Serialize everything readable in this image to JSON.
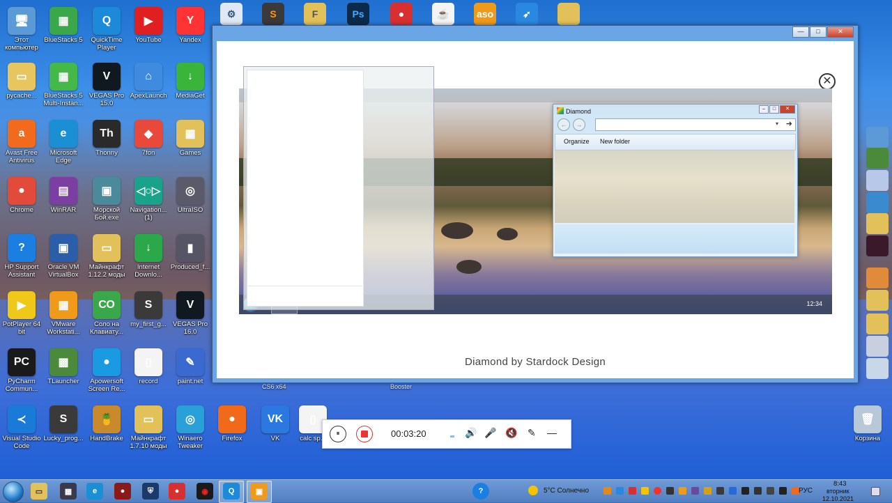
{
  "desktop_icons": [
    {
      "label": "Этот компьютер",
      "glyph": "🖥",
      "color": "#5b9ad6",
      "icon": "computer-icon"
    },
    {
      "label": "BlueStacks 5",
      "glyph": "▦",
      "color": "#3aa84a",
      "icon": "bluestacks-icon"
    },
    {
      "label": "QuickTime Player",
      "glyph": "Q",
      "color": "#1c8ad8",
      "icon": "quicktime-icon"
    },
    {
      "label": "YouTube",
      "glyph": "▶",
      "color": "#e02020",
      "icon": "youtube-icon"
    },
    {
      "label": "Yandex",
      "glyph": "Y",
      "color": "#f33",
      "icon": "yandex-icon"
    },
    {
      "label": "рycache...",
      "glyph": "▭",
      "color": "#e7c660",
      "icon": "folder-icon"
    },
    {
      "label": "BlueStacks 5 Multi-Instan...",
      "glyph": "▦",
      "color": "#45b84a",
      "icon": "bluestacks-multi-icon"
    },
    {
      "label": "VEGAS Pro 15.0",
      "glyph": "V",
      "color": "#101820",
      "icon": "vegas-icon"
    },
    {
      "label": "ApexLaunch",
      "glyph": "⌂",
      "color": "#3f8be0",
      "icon": "apexlauncher-icon"
    },
    {
      "label": "MediaGet",
      "glyph": "↓",
      "color": "#3bb43b",
      "icon": "mediaget-icon"
    },
    {
      "label": "Avast Free Antivirus",
      "glyph": "a",
      "color": "#f26a1b",
      "icon": "avast-icon"
    },
    {
      "label": "Microsoft Edge",
      "glyph": "e",
      "color": "#1a8fd4",
      "icon": "edge-icon"
    },
    {
      "label": "Thonny",
      "glyph": "Th",
      "color": "#2a2a2a",
      "icon": "thonny-icon"
    },
    {
      "label": "7fon",
      "glyph": "◆",
      "color": "#e9493a",
      "icon": "7fon-icon"
    },
    {
      "label": "Games",
      "glyph": "▦",
      "color": "#e2c15a",
      "icon": "games-icon"
    },
    {
      "label": "Chrome",
      "glyph": "●",
      "color": "#e24a3a",
      "icon": "chrome-icon"
    },
    {
      "label": "WinRAR",
      "glyph": "▤",
      "color": "#7a3fa0",
      "icon": "winrar-icon"
    },
    {
      "label": "Морской Бой.exe",
      "glyph": "▣",
      "color": "#4a8a9a",
      "icon": "battleship-icon"
    },
    {
      "label": "Navigation... (1)",
      "glyph": "◁○▷",
      "color": "#1aa38a",
      "icon": "navigation-icon"
    },
    {
      "label": "UltraISO",
      "glyph": "◎",
      "color": "#5a5a6a",
      "icon": "ultraiso-icon"
    },
    {
      "label": "HP Support Assistant",
      "glyph": "?",
      "color": "#1a7fe0",
      "icon": "hp-support-icon"
    },
    {
      "label": "Oracle VM VirtualBox",
      "glyph": "▣",
      "color": "#2a5ea8",
      "icon": "virtualbox-icon"
    },
    {
      "label": "Майнкрафт 1.12.2 моды",
      "glyph": "▭",
      "color": "#e2c15a",
      "icon": "folder-icon"
    },
    {
      "label": "Internet Downlo...",
      "glyph": "↓",
      "color": "#2aa84a",
      "icon": "idm-icon"
    },
    {
      "label": "Produced_f...",
      "glyph": "▮",
      "color": "#556",
      "icon": "file-icon"
    },
    {
      "label": "PotPlayer 64 bit",
      "glyph": "▶",
      "color": "#f0c81a",
      "icon": "potplayer-icon"
    },
    {
      "label": "VMware Workstati...",
      "glyph": "▦",
      "color": "#f09a1a",
      "icon": "vmware-icon"
    },
    {
      "label": "Соло на Клавиату...",
      "glyph": "СО",
      "color": "#3aa84a",
      "icon": "solo-icon"
    },
    {
      "label": "my_first_g...",
      "glyph": "S",
      "color": "#3a3a3a",
      "icon": "sublime-icon"
    },
    {
      "label": "VEGAS Pro 16.0",
      "glyph": "V",
      "color": "#101820",
      "icon": "vegas16-icon"
    },
    {
      "label": "PyCharm Commun...",
      "glyph": "PC",
      "color": "#1a1a1a",
      "icon": "pycharm-icon"
    },
    {
      "label": "TLauncher",
      "glyph": "▩",
      "color": "#4a8a3a",
      "icon": "tlauncher-icon"
    },
    {
      "label": "Apowersoft Screen Re...",
      "glyph": "●",
      "color": "#1a9ae0",
      "icon": "apowersoft-icon"
    },
    {
      "label": "record",
      "glyph": "▯",
      "color": "#f4f4f4",
      "icon": "file-icon"
    },
    {
      "label": "paint.net",
      "glyph": "✎",
      "color": "#3a6ad0",
      "icon": "paintnet-icon"
    },
    {
      "label": "Visual Studio Code",
      "glyph": "≺",
      "color": "#1a7ad8",
      "icon": "vscode-icon"
    },
    {
      "label": "Lucky_prog...",
      "glyph": "S",
      "color": "#3a3a3a",
      "icon": "sublime-icon"
    },
    {
      "label": "HandBrake",
      "glyph": "🍍",
      "color": "#c88a2a",
      "icon": "handbrake-icon"
    },
    {
      "label": "Майнкрафт 1.7.10 моды",
      "glyph": "▭",
      "color": "#e2c15a",
      "icon": "folder-icon"
    },
    {
      "label": "Winaero Tweaker",
      "glyph": "◎",
      "color": "#2aa0d8",
      "icon": "winaero-icon"
    },
    {
      "label": "Firefox",
      "glyph": "●",
      "color": "#f06a1a",
      "icon": "firefox-icon"
    },
    {
      "label": "VK",
      "glyph": "VK",
      "color": "#2a78e0",
      "icon": "vk-icon"
    },
    {
      "label": "calc sp...",
      "glyph": "▯",
      "color": "#f4f4f4",
      "icon": "file-icon"
    },
    {
      "label": "Корзина",
      "glyph": "🗑",
      "color": "#b8c8d8",
      "icon": "recycle-bin-icon"
    }
  ],
  "background_labels": {
    "cs6": "CS6 x64",
    "booster": "Booster"
  },
  "main_window": {
    "min": "—",
    "max": "□",
    "close": "✕",
    "close_circle": "✕",
    "caption": "Diamond by Stardock Design",
    "preview": {
      "clock": "12:34",
      "explorer": {
        "title": "Diamond",
        "toolbar": {
          "organize": "Organize",
          "new_folder": "New folder"
        },
        "back": "←",
        "forward": "→",
        "dropdown": "▾",
        "go": "➜"
      }
    }
  },
  "recorder": {
    "pause": "⏸",
    "time": "00:03:20",
    "volume": "🔊",
    "mic": "🎤",
    "camera": "🔇",
    "pen": "✎",
    "minimize": "—"
  },
  "taskbar": {
    "help": "?",
    "weather": "5°C Солнечно",
    "lang": "РУС",
    "time": "8:43",
    "day": "вторник",
    "date": "12.10.2021"
  }
}
